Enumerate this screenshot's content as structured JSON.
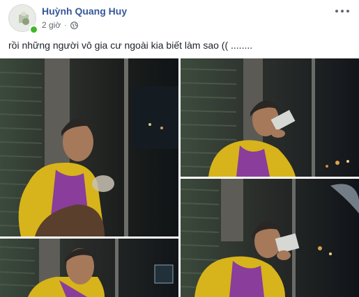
{
  "post": {
    "author": "Huỳnh Quang Huy",
    "timestamp": "2 giờ",
    "separator": "·",
    "privacy_icon": "globe-icon",
    "more_icon": "more-options-icon",
    "text": "rồi những người vô gia cư ngoài kia biết làm sao (( ........"
  },
  "photos": [
    {
      "name": "photo-1",
      "description_icon": "photo"
    },
    {
      "name": "photo-2",
      "description_icon": "photo"
    },
    {
      "name": "photo-3",
      "description_icon": "photo"
    },
    {
      "name": "photo-4",
      "description_icon": "photo"
    }
  ],
  "colors": {
    "author": "#365899",
    "online": "#42b72a",
    "raincoat": "#e3c21f",
    "purple": "#8a3d9a"
  }
}
